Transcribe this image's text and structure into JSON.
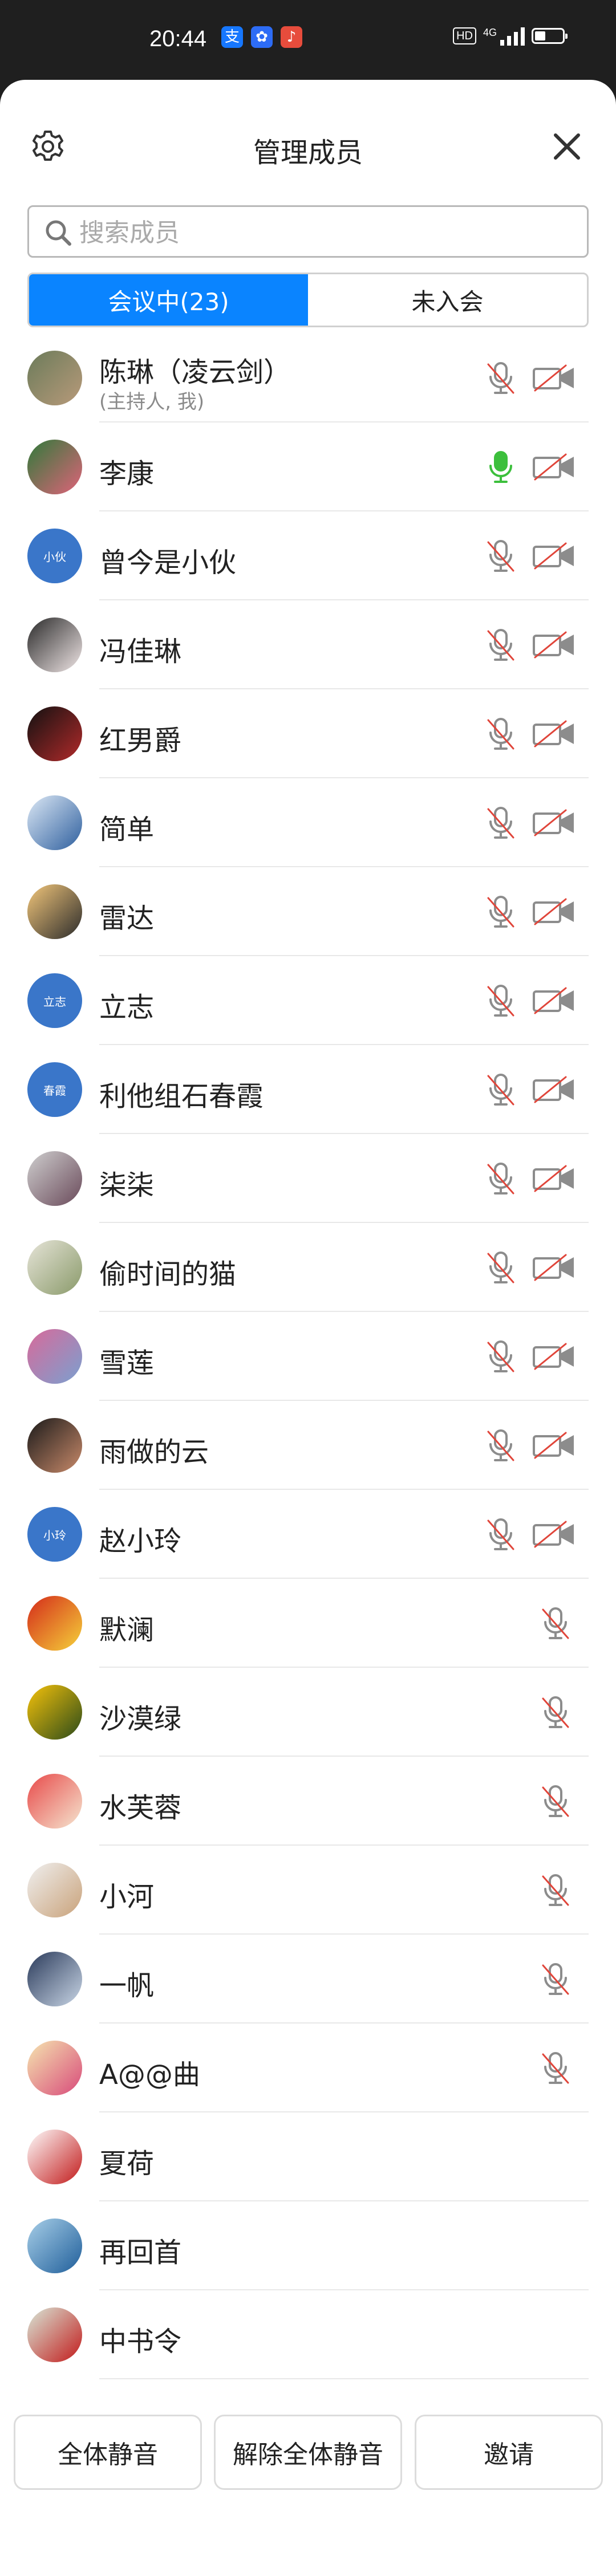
{
  "status_bar": {
    "time": "20:44",
    "apps": [
      {
        "glyph": "支",
        "color": "#1677ff"
      },
      {
        "glyph": "✿",
        "color": "#2d6cf5"
      },
      {
        "glyph": "♪",
        "color": "#e74c3c"
      }
    ],
    "hd": "HD",
    "network": "4G",
    "battery_level": 0.4
  },
  "header": {
    "title": "管理成员"
  },
  "search": {
    "placeholder": "搜索成员",
    "value": ""
  },
  "tabs": [
    {
      "label": "会议中(23)",
      "active": true
    },
    {
      "label": "未入会",
      "active": false
    }
  ],
  "members": [
    {
      "name": "陈琳（凌云剑）",
      "sub": "(主持人, 我)",
      "avatar": "photo",
      "colors": [
        "#6b7b5a",
        "#b89a7a"
      ],
      "mic": "muted",
      "camera": "off"
    },
    {
      "name": "李康",
      "avatar": "photo",
      "colors": [
        "#2f7a3a",
        "#e0637a"
      ],
      "mic": "on",
      "camera": "off"
    },
    {
      "name": "曾今是小伙",
      "avatar": "initials",
      "initials": "小伙",
      "mic": "muted",
      "camera": "off"
    },
    {
      "name": "冯佳琳",
      "avatar": "photo",
      "colors": [
        "#2a2a2a",
        "#f0e6e6"
      ],
      "mic": "muted",
      "camera": "off"
    },
    {
      "name": "红男爵",
      "avatar": "photo",
      "colors": [
        "#111111",
        "#b22a2a"
      ],
      "mic": "muted",
      "camera": "off"
    },
    {
      "name": "简单",
      "avatar": "photo",
      "colors": [
        "#dce8f5",
        "#2e5f9e"
      ],
      "mic": "muted",
      "camera": "off"
    },
    {
      "name": "雷达",
      "avatar": "photo",
      "colors": [
        "#f2c67a",
        "#2b2b2b"
      ],
      "mic": "muted",
      "camera": "off"
    },
    {
      "name": "立志",
      "avatar": "initials",
      "initials": "立志",
      "mic": "muted",
      "camera": "off"
    },
    {
      "name": "利他组石春霞",
      "avatar": "initials",
      "initials": "春霞",
      "mic": "muted",
      "camera": "off"
    },
    {
      "name": "柒柒",
      "avatar": "photo",
      "colors": [
        "#cfcfcf",
        "#6a4a5a"
      ],
      "mic": "muted",
      "camera": "off"
    },
    {
      "name": "偷时间的猫",
      "avatar": "photo",
      "colors": [
        "#e6e4d8",
        "#8a9a6a"
      ],
      "mic": "muted",
      "camera": "off"
    },
    {
      "name": "雪莲",
      "avatar": "photo",
      "colors": [
        "#d86a9a",
        "#7aa0d0"
      ],
      "mic": "muted",
      "camera": "off"
    },
    {
      "name": "雨做的云",
      "avatar": "photo",
      "colors": [
        "#1a1a1a",
        "#c98a6a"
      ],
      "mic": "muted",
      "camera": "off"
    },
    {
      "name": "赵小玲",
      "avatar": "initials",
      "initials": "小玲",
      "mic": "muted",
      "camera": "off"
    },
    {
      "name": "默澜",
      "avatar": "photo",
      "colors": [
        "#d42a1a",
        "#f5d23a"
      ],
      "mic": "muted",
      "camera": "none"
    },
    {
      "name": "沙漠绿",
      "avatar": "photo",
      "colors": [
        "#f5c20a",
        "#2a4a1a"
      ],
      "mic": "muted",
      "camera": "none"
    },
    {
      "name": "水芙蓉",
      "avatar": "photo",
      "colors": [
        "#e84a4a",
        "#f5e6d0"
      ],
      "mic": "muted",
      "camera": "none"
    },
    {
      "name": "小河",
      "avatar": "photo",
      "colors": [
        "#f0f0f0",
        "#c9a27a"
      ],
      "mic": "muted",
      "camera": "none"
    },
    {
      "name": "一帆",
      "avatar": "photo",
      "colors": [
        "#2a3a5a",
        "#c9d6e6"
      ],
      "mic": "muted",
      "camera": "none"
    },
    {
      "name": "A@@曲",
      "avatar": "photo",
      "colors": [
        "#f5e6b0",
        "#d84a7a"
      ],
      "mic": "muted",
      "camera": "none"
    },
    {
      "name": "夏荷",
      "avatar": "photo",
      "colors": [
        "#ffffff",
        "#c21a1a"
      ],
      "mic": "none",
      "camera": "none"
    },
    {
      "name": "再回首",
      "avatar": "photo",
      "colors": [
        "#a8cfe8",
        "#1f5e9a"
      ],
      "mic": "none",
      "camera": "none"
    },
    {
      "name": "中书令",
      "avatar": "photo",
      "colors": [
        "#d8e8d8",
        "#c21a1a"
      ],
      "mic": "none",
      "camera": "none"
    }
  ],
  "footer": {
    "mute_all": "全体静音",
    "unmute_all": "解除全体静音",
    "invite": "邀请"
  },
  "colors": {
    "accent": "#0a84ff",
    "mic_on": "#3cbf3c",
    "muted_slash": "#e0453a",
    "icon_gray": "#8c8c8c"
  }
}
